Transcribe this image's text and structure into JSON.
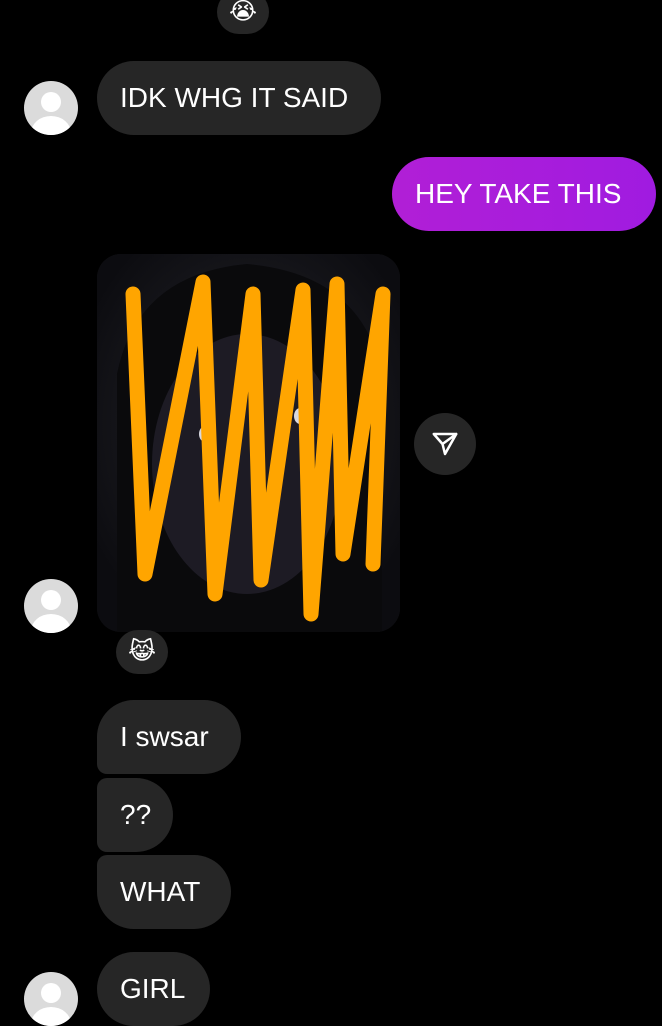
{
  "reactions": {
    "top": "😭",
    "photo": "😹"
  },
  "messages": {
    "idk": "IDK WHG IT SAID",
    "hey": "HEY TAKE THIS",
    "swsar": "I swsar",
    "qq": "??",
    "what": "WHAT",
    "girl": "GIRL"
  },
  "colors": {
    "background": "#000000",
    "received_bubble": "#262626",
    "sent_bubble": "#a61ad8",
    "scribble": "#ffa500"
  },
  "icons": {
    "share": "paper-plane-icon",
    "avatar": "default-avatar-icon"
  }
}
